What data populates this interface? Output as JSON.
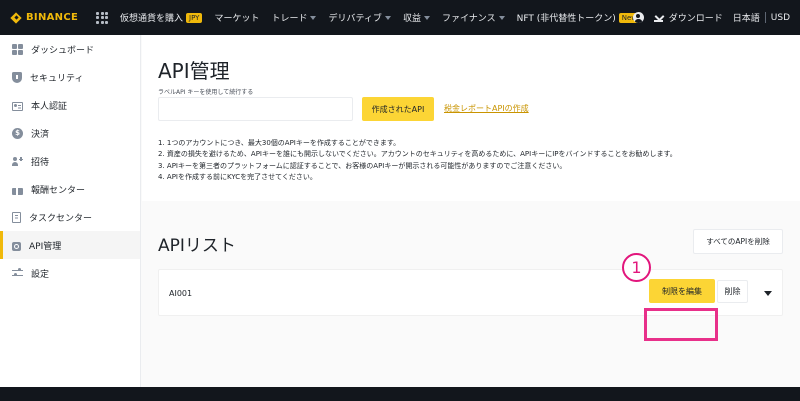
{
  "topbar": {
    "brand": "BINANCE",
    "nav": [
      {
        "label": "仮想通貨を購入",
        "badge": "JPY",
        "dropdown": false
      },
      {
        "label": "マーケット",
        "badge": "",
        "dropdown": false
      },
      {
        "label": "トレード",
        "badge": "",
        "dropdown": true
      },
      {
        "label": "デリバティブ",
        "badge": "",
        "dropdown": true
      },
      {
        "label": "収益",
        "badge": "",
        "dropdown": true
      },
      {
        "label": "ファイナンス",
        "badge": "",
        "dropdown": true
      },
      {
        "label": "NFT (非代替性トークン)",
        "badge": "New",
        "dropdown": false
      }
    ],
    "download": "ダウンロード",
    "language": "日本語",
    "currency": "USD"
  },
  "sidebar": {
    "items": [
      {
        "label": "ダッシュボード",
        "icon": "dashboard-icon"
      },
      {
        "label": "セキュリティ",
        "icon": "shield-icon"
      },
      {
        "label": "本人認証",
        "icon": "id-card-icon"
      },
      {
        "label": "決済",
        "icon": "dollar-coin-icon"
      },
      {
        "label": "招待",
        "icon": "invite-user-icon"
      },
      {
        "label": "報酬センター",
        "icon": "reward-ticket-icon"
      },
      {
        "label": "タスクセンター",
        "icon": "task-clipboard-icon"
      },
      {
        "label": "API管理",
        "icon": "api-icon"
      },
      {
        "label": "設定",
        "icon": "settings-sliders-icon"
      }
    ],
    "active_index": 7
  },
  "api_create": {
    "title": "API管理",
    "label_hint": "ラベルAPI キーを使用して続行する",
    "input_value": "",
    "create_button": "作成されたAPI",
    "tax_link": "税金レポートAPIの作成"
  },
  "notes": [
    "1. 1つのアカウントにつき、最大30個のAPIキーを作成することができます。",
    "2. 資産の損失を避けるため、APIキーを誰にも開示しないでください。アカウントのセキュリティを高めるために、APIキーにIPをバインドすることをお勧めします。",
    "3. APIキーを第三者のプラットフォームに認証することで、お客様のAPIキーが開示される可能性がありますのでご注意ください。",
    "4. APIを作成する前にKYCを完了させてください。"
  ],
  "api_list": {
    "title": "APIリスト",
    "delete_all_button": "すべてのAPIを削除",
    "rows": [
      {
        "name": "AI001",
        "edit_button": "制限を編集",
        "delete_button": "削除"
      }
    ]
  },
  "annotation": {
    "callout_number": "1",
    "color": "#e2167c"
  },
  "colors": {
    "brand_yellow": "#f0b90b",
    "button_yellow": "#fcd535",
    "topbar_bg": "#12161c",
    "link": "#c99400"
  }
}
